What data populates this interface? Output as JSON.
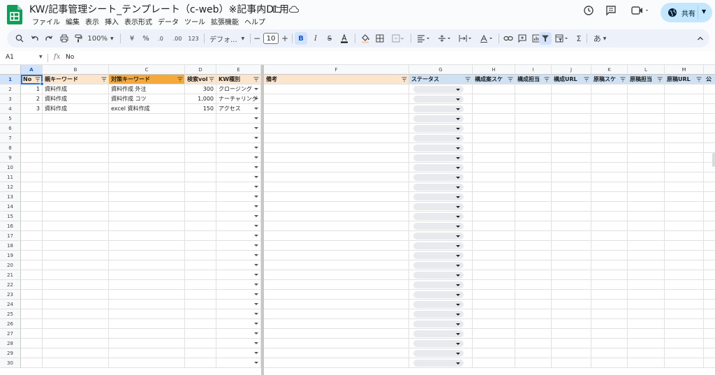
{
  "app": {
    "title": "KW/記事管理シート_テンプレート（c-web）※記事内DL用",
    "menu": [
      "ファイル",
      "編集",
      "表示",
      "挿入",
      "表示形式",
      "データ",
      "ツール",
      "拡張機能",
      "ヘルプ"
    ],
    "share_label": "共有"
  },
  "toolbar": {
    "zoom": "100%",
    "currency": "¥",
    "percent": "%",
    "dec_decrease": ".0",
    "dec_increase": ".00",
    "number_format": "123",
    "font": "デフォ...",
    "font_size": "10",
    "input_tool": "あ"
  },
  "formula_bar": {
    "name_box": "A1",
    "fx": "fx",
    "content": "No"
  },
  "colors": {
    "accent": "#1a73e8",
    "header_gold": "#fce5cd",
    "header_orange": "#f6a93b",
    "header_blue": "#cfe2f3",
    "header_green": "#d9ead3",
    "status_chip": "#e8eaed"
  },
  "sheet": {
    "column_letters": [
      "A",
      "B",
      "C",
      "D",
      "E",
      "F",
      "G",
      "H",
      "I",
      "J",
      "K",
      "L",
      "M",
      ""
    ],
    "headers": [
      "No",
      "親キーワード",
      "対策キーワード",
      "検索vol",
      "KW種別",
      "備考",
      "ステータス",
      "構成案スケ",
      "構成担当",
      "構成URL",
      "原稿スケ",
      "原稿担当",
      "原稿URL",
      "公"
    ],
    "rows": [
      {
        "no": "1",
        "parent": "資料作成",
        "target": "資料作成 外注",
        "vol": "300",
        "kind": "クロージング"
      },
      {
        "no": "2",
        "parent": "資料作成",
        "target": "資料作成 コツ",
        "vol": "1,000",
        "kind": "ナーチャリング"
      },
      {
        "no": "3",
        "parent": "資料作成",
        "target": "excel 資料作成",
        "vol": "150",
        "kind": "アクセス"
      }
    ],
    "row_numbers": [
      "1",
      "2",
      "3",
      "4",
      "5",
      "6",
      "7",
      "8",
      "9",
      "10",
      "11",
      "12",
      "13",
      "14",
      "15",
      "16",
      "17",
      "18",
      "19",
      "20",
      "21",
      "22",
      "23",
      "24",
      "25",
      "26",
      "27",
      "28",
      "29",
      "30"
    ]
  }
}
